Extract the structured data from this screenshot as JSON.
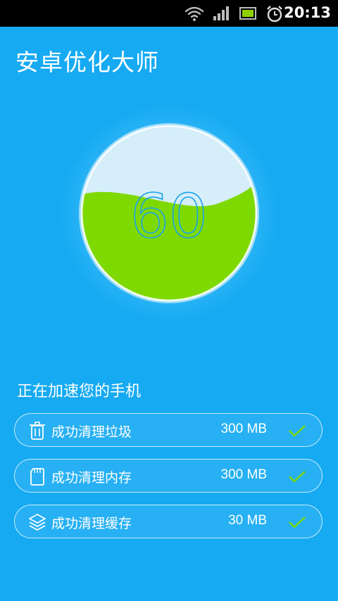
{
  "status_bar": {
    "time": "20:13",
    "icons": [
      "wifi-icon",
      "signal-icon",
      "battery-icon",
      "alarm-icon"
    ]
  },
  "app": {
    "title": "安卓优化大师"
  },
  "gauge": {
    "score": "60",
    "fill_level": 0.6,
    "fill_color": "#7ed900",
    "empty_color": "#d5eef9",
    "number_color": "#1aa3ee"
  },
  "status_heading": "正在加速您的手机",
  "results": [
    {
      "icon": "trash-icon",
      "label": "成功清理垃圾",
      "size": "300 MB"
    },
    {
      "icon": "sd-card-icon",
      "label": "成功清理内存",
      "size": "300 MB"
    },
    {
      "icon": "layers-icon",
      "label": "成功清理缓存",
      "size": "30 MB"
    }
  ],
  "colors": {
    "background": "#15aaf2",
    "check": "#7ed900"
  }
}
